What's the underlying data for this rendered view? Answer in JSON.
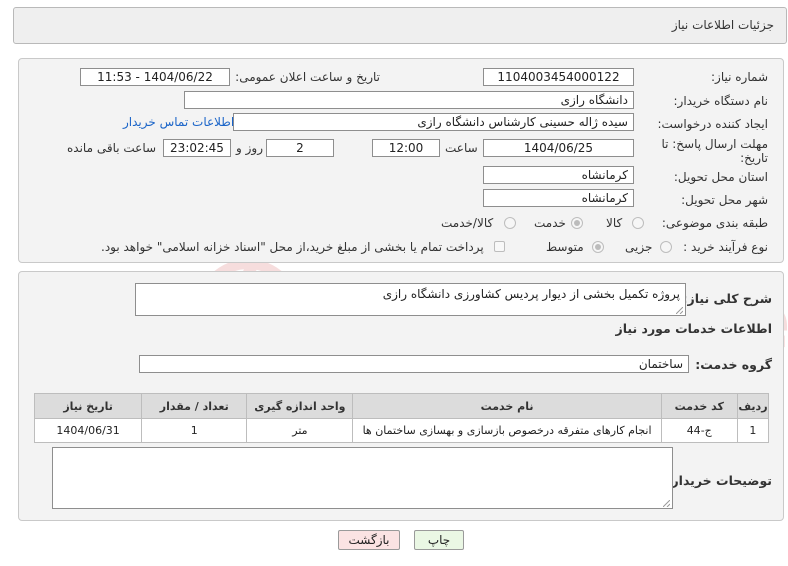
{
  "header": {
    "title": "جزئیات اطلاعات نیاز"
  },
  "form": {
    "need_number_label": "شماره نیاز:",
    "need_number": "1104003454000122",
    "announce_label": "تاریخ و ساعت اعلان عمومی:",
    "announce_value": "1404/06/22 - 11:53",
    "buyer_org_label": "نام دستگاه خریدار:",
    "buyer_org": "دانشگاه رازی",
    "creator_label": "ایجاد کننده درخواست:",
    "creator": "سیده ژاله حسینی کارشناس دانشگاه رازی",
    "contact_link": "اطلاعات تماس خریدار",
    "deadline_label_line1": "مهلت ارسال پاسخ: تا",
    "deadline_label_line2": "تاریخ:",
    "deadline_date": "1404/06/25",
    "time_label": "ساعت",
    "deadline_time": "12:00",
    "days_value": "2",
    "days_label": "روز و",
    "remaining_time": "23:02:45",
    "remaining_label": "ساعت باقی مانده",
    "province_label": "استان محل تحویل:",
    "province": "کرمانشاه",
    "city_label": "شهر محل تحویل:",
    "city": "کرمانشاه",
    "category_label": "طبقه بندی موضوعی:",
    "category_options": [
      "کالا",
      "خدمت",
      "کالا/خدمت"
    ],
    "category_selected": "خدمت",
    "process_label": "نوع فرآیند خرید :",
    "process_options": [
      "جزیی",
      "متوسط"
    ],
    "process_selected": "متوسط",
    "payment_note": "پرداخت تمام یا بخشی از مبلغ خرید،از محل \"اسناد خزانه اسلامی\" خواهد بود."
  },
  "details": {
    "summary_label": "شرح کلی نیاز:",
    "summary": "پروژه تکمیل بخشی از دیوار پردیس کشاورزی دانشگاه رازی",
    "services_heading": "اطلاعات خدمات مورد نیاز",
    "service_group_label": "گروه خدمت:",
    "service_group": "ساختمان",
    "table_headers": [
      "ردیف",
      "کد خدمت",
      "نام خدمت",
      "واحد اندازه گیری",
      "تعداد / مقدار",
      "تاریخ نیاز"
    ],
    "table_rows": [
      [
        "1",
        "ج-44",
        "انجام کارهای متفرقه درخصوص بازسازی و بهسازی ساختمان ها",
        "متر",
        "1",
        "1404/06/31"
      ]
    ],
    "buyer_notes_label": "توضیحات خریدار:",
    "buyer_notes": ""
  },
  "buttons": {
    "print": "چاپ",
    "back": "بازگشت"
  },
  "watermark_text": "AriaTender.net",
  "colors": {
    "link": "#1a64c8",
    "print_bg": "#eaf7e4",
    "back_bg": "#fbe3e3",
    "watermark": "#c00000"
  }
}
